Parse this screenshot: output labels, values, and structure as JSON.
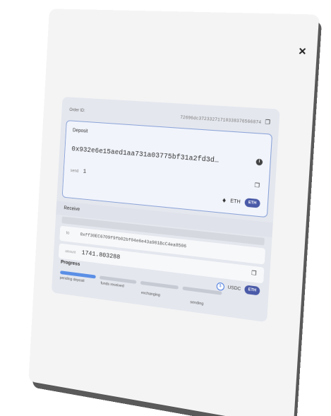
{
  "modal": {
    "close_label": "×"
  },
  "order": {
    "label": "Order ID:",
    "id": "72696dc37233271710338376566874"
  },
  "deposit": {
    "title": "Deposit",
    "address": "0x932e6e15aed1aa731a03775bf31a2fd3d…",
    "send_label": "send",
    "send_value": "1",
    "coin": "ETH",
    "network": "ETH"
  },
  "receive": {
    "title": "Receive",
    "to_label": "to",
    "to_value": "0xff30EC6709f9fb02bf04e6e43a901BcC4ea8506",
    "amount_label": "amount",
    "amount_value": "1741.803288",
    "coin": "USDC",
    "network": "ETH"
  },
  "progress": {
    "title": "Progress",
    "steps": [
      {
        "label": "pending deposit",
        "active": true
      },
      {
        "label": "funds received",
        "active": false
      },
      {
        "label": "exchanging",
        "active": false
      },
      {
        "label": "sending",
        "active": false
      }
    ]
  },
  "colors": {
    "accent": "#5b8fe6",
    "badge": "#4a5aa8",
    "deposit_border": "#8aa2d8"
  },
  "icons": {
    "close": "close-icon",
    "copy": "copy-icon",
    "info": "info-icon",
    "eth": "eth-icon",
    "usdc": "usdc-icon"
  }
}
